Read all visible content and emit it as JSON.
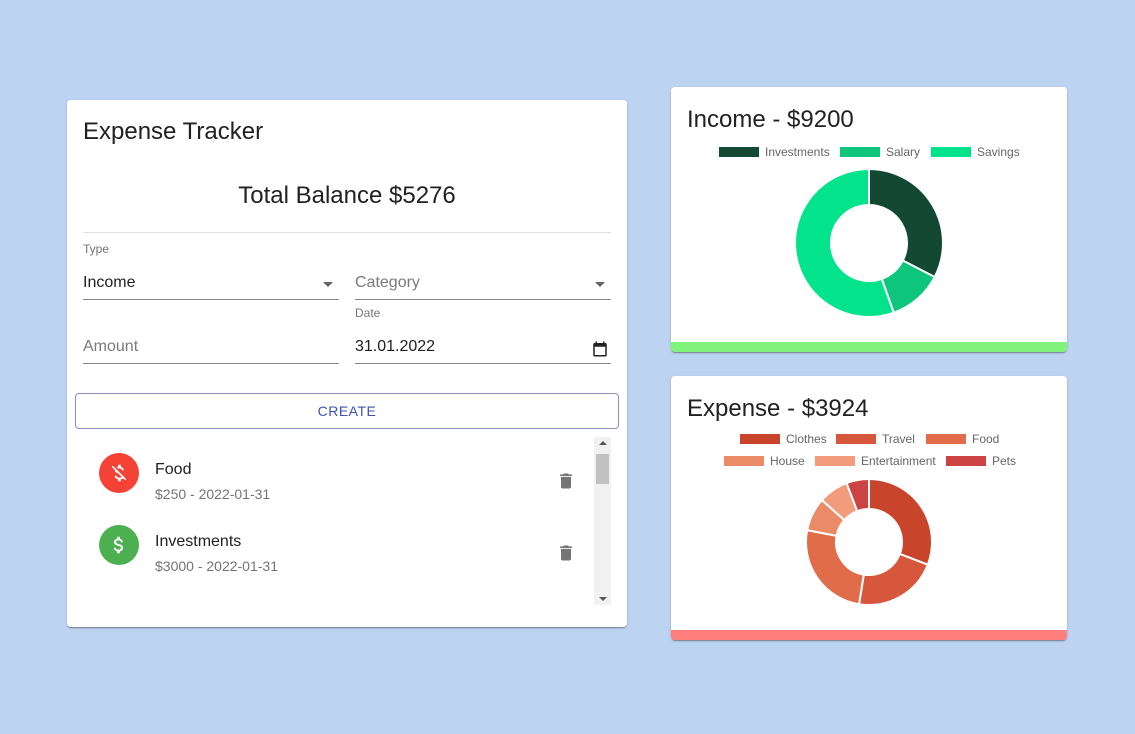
{
  "tracker": {
    "title": "Expense Tracker",
    "balance": "Total Balance $5276",
    "type_label": "Type",
    "type_value": "Income",
    "category_placeholder": "Category",
    "amount_placeholder": "Amount",
    "date_label": "Date",
    "date_value": "31.01.2022",
    "create_label": "CREATE",
    "transactions": [
      {
        "name": "Food",
        "detail": "$250 - 2022-01-31",
        "kind": "expense",
        "color": "#f44336"
      },
      {
        "name": "Investments",
        "detail": "$3000 - 2022-01-31",
        "kind": "income",
        "color": "#4caf50"
      }
    ]
  },
  "income": {
    "title": "Income - $9200",
    "bar_color": "#80f47a",
    "chart_data": {
      "type": "pie",
      "categories": [
        "Investments",
        "Salary",
        "Savings"
      ],
      "values": [
        3000,
        1100,
        5100
      ],
      "colors": [
        "#134932",
        "#0dc57d",
        "#03e38c"
      ]
    }
  },
  "expense": {
    "title": "Expense - $3924",
    "bar_color": "#ff7f7f",
    "chart_data": {
      "type": "pie",
      "categories": [
        "Clothes",
        "Travel",
        "Food",
        "House",
        "Entertainment",
        "Pets"
      ],
      "values": [
        1211,
        850,
        1000,
        336,
        300,
        227
      ],
      "colors": [
        "#c8452c",
        "#d6573b",
        "#e06c4a",
        "#ea8a66",
        "#f29c7d",
        "#cb4343"
      ]
    }
  }
}
